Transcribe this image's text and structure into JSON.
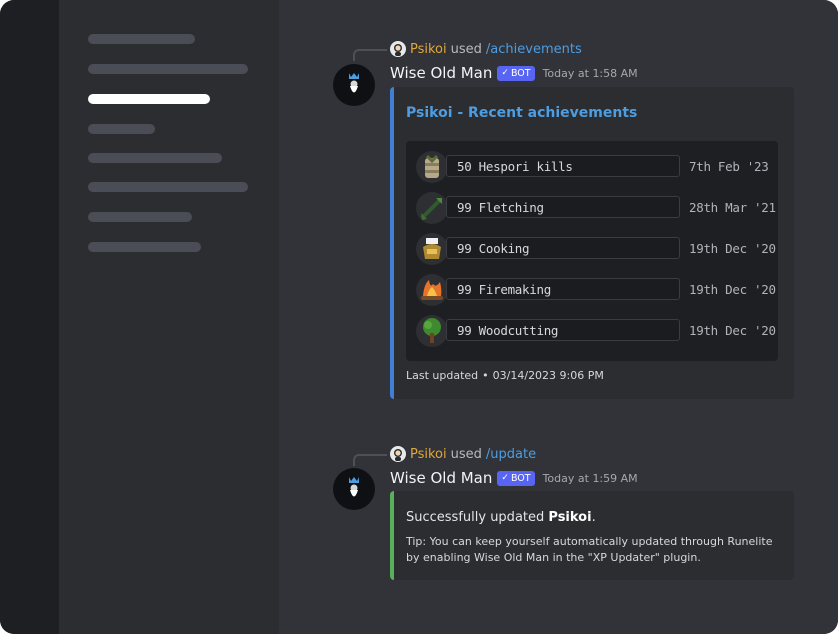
{
  "sidebar": {
    "items": [
      "",
      "",
      "",
      "",
      "",
      "",
      "",
      ""
    ],
    "active_index": 2
  },
  "messages": [
    {
      "reply": {
        "user": "Psikoi",
        "verb": "used",
        "command": "/achievements"
      },
      "author": "Wise Old Man",
      "bot_tag": "BOT",
      "time": "Today at 1:58 AM",
      "embed": {
        "title": "Psikoi - Recent achievements",
        "accent_color": "#3f7fd6",
        "achievements": [
          {
            "icon": "hespori-icon",
            "label": "50 Hespori kills",
            "date": "7th Feb '23"
          },
          {
            "icon": "fletching-icon",
            "label": "99 Fletching",
            "date": "28th Mar '21"
          },
          {
            "icon": "cooking-icon",
            "label": "99 Cooking",
            "date": "19th Dec '20"
          },
          {
            "icon": "firemaking-icon",
            "label": "99 Firemaking",
            "date": "19th Dec '20"
          },
          {
            "icon": "woodcutting-icon",
            "label": "99 Woodcutting",
            "date": "19th Dec '20"
          }
        ],
        "footer_label": "Last updated",
        "footer_sep": "•",
        "footer_time": "03/14/2023 9:06 PM"
      }
    },
    {
      "reply": {
        "user": "Psikoi",
        "verb": "used",
        "command": "/update"
      },
      "author": "Wise Old Man",
      "bot_tag": "BOT",
      "time": "Today at 1:59 AM",
      "embed": {
        "accent_color": "#58b05d",
        "text_prefix": "Successfully updated ",
        "text_user": "Psikoi",
        "text_suffix": ".",
        "tip": "Tip: You can keep yourself automatically updated through Runelite by enabling Wise Old Man in the \"XP Updater\" plugin."
      }
    }
  ]
}
